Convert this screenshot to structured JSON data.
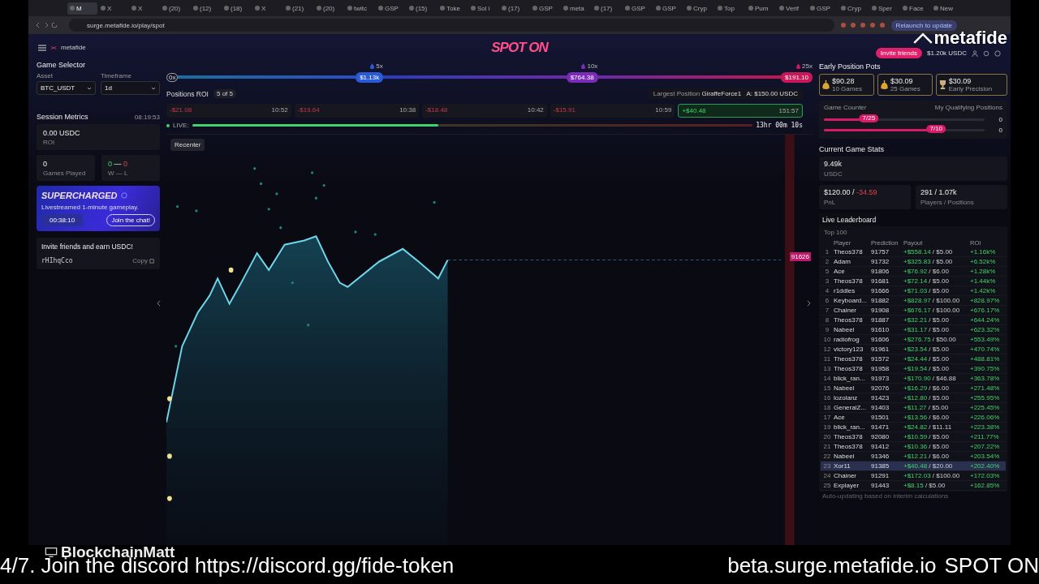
{
  "browser": {
    "tabs": [
      {
        "label": "M",
        "selected": true
      },
      {
        "label": "X",
        "selected": false
      },
      {
        "label": "X",
        "selected": false
      },
      {
        "label": "(20)",
        "selected": false
      },
      {
        "label": "(12)",
        "selected": false
      },
      {
        "label": "(18)",
        "selected": false
      },
      {
        "label": "X",
        "selected": false
      },
      {
        "label": "(21)",
        "selected": false
      },
      {
        "label": "(20)",
        "selected": false
      },
      {
        "label": "twitc",
        "selected": false
      },
      {
        "label": "GSP",
        "selected": false
      },
      {
        "label": "(15)",
        "selected": false
      },
      {
        "label": "Toke",
        "selected": false
      },
      {
        "label": "Sol i",
        "selected": false
      },
      {
        "label": "(17)",
        "selected": false
      },
      {
        "label": "GSP",
        "selected": false
      },
      {
        "label": "meta",
        "selected": false
      },
      {
        "label": "(17)",
        "selected": false
      },
      {
        "label": "GSP",
        "selected": false
      },
      {
        "label": "GSP",
        "selected": false
      },
      {
        "label": "Cryp",
        "selected": false
      },
      {
        "label": "Top",
        "selected": false
      },
      {
        "label": "Pum",
        "selected": false
      },
      {
        "label": "Verif",
        "selected": false
      },
      {
        "label": "GSP",
        "selected": false
      },
      {
        "label": "Cryp",
        "selected": false
      },
      {
        "label": "Sper",
        "selected": false
      },
      {
        "label": "Face",
        "selected": false
      },
      {
        "label": "New",
        "selected": false
      }
    ],
    "address": "surge.metafide.io/play/spot",
    "relaunch": "Relaunch to update"
  },
  "overlay": {
    "brand_logo": "metafide",
    "streamer": "BlockchainMatt",
    "ticker_left": "4/7. Join the discord https://discord.gg/fide-token",
    "ticker_site": "beta.surge.metafide.io",
    "ticker_end": "SPOT ON"
  },
  "header": {
    "brand": "metafide",
    "title": "SPOT ON",
    "invite_button": "Invite friends",
    "balance": "$1.20k USDC"
  },
  "sidebar": {
    "game_selector": {
      "title": "Game Selector",
      "asset_label": "Asset",
      "asset": "BTC_USDT",
      "timeframe_label": "Timeframe",
      "timeframe": "1d"
    },
    "session": {
      "title": "Session Metrics",
      "clock": "08:19:53",
      "roi_value": "0.00 USDC",
      "roi_label": "ROI",
      "games_value": "0",
      "games_label": "Games Played",
      "wins": "0",
      "wl_separator": "—",
      "losses": "0",
      "wl_label": "W — L"
    },
    "supercharged": {
      "title": "SUPERCHARGED",
      "text": "Livestreamed 1-minute gameplay.",
      "timer": "00:38:10",
      "button": "Join the chat!"
    },
    "invite": {
      "title": "Invite friends and earn USDC!",
      "code": "rHIhqCco",
      "copy": "Copy"
    }
  },
  "multiplier": {
    "start": "0x",
    "markers": [
      {
        "label": "5x",
        "value": "$1.13k",
        "color": "#2a5bd7"
      },
      {
        "label": "10x",
        "value": "$764.38",
        "color": "#7a2bb8"
      },
      {
        "label": "25x",
        "value": "$191.10",
        "color": "#c8185a"
      }
    ]
  },
  "positions": {
    "title": "Positions ROI",
    "count": "5 of 5",
    "largest_label": "Largest Position",
    "largest_name": "GiraffeForce1",
    "largest_amount": "A: $150.00 USDC",
    "cards": [
      {
        "amount": "-$21.08",
        "time": "10:52",
        "kind": "loss"
      },
      {
        "amount": "-$19.64",
        "time": "10:38",
        "kind": "loss"
      },
      {
        "amount": "-$18.48",
        "time": "10:42",
        "kind": "loss"
      },
      {
        "amount": "-$15.91",
        "time": "10:59",
        "kind": "loss"
      },
      {
        "amount": "+$40.48",
        "time": "151:57",
        "kind": "gain"
      }
    ]
  },
  "live": {
    "label": "LIVE:",
    "level": 0.44,
    "countdown": "13hr 00m 10s"
  },
  "chart": {
    "recenter": "Recenter",
    "price_tag": "91626"
  },
  "pots": {
    "title": "Early Position Pots",
    "cards": [
      {
        "amount": "$90.28",
        "label": "10 Games",
        "kind": "bag"
      },
      {
        "amount": "$30.09",
        "label": "25 Games",
        "kind": "bag"
      },
      {
        "amount": "$30.09",
        "label": "Early Precision",
        "kind": "trophy"
      }
    ],
    "counter_label": "Game Counter",
    "qualifying_label": "My Qualifying Positions",
    "counters": [
      {
        "label": "7/25",
        "level": 0.28,
        "value": "0"
      },
      {
        "label": "7/10",
        "level": 0.7,
        "value": "0"
      }
    ]
  },
  "stats": {
    "title": "Current Game Stats",
    "volume": "9.49k",
    "volume_label": "USDC",
    "pnl_pos": "$120.00",
    "pnl_separator": "/",
    "pnl_neg": "-34.59",
    "pnl_label": "PnL",
    "players": "291 / 1.07k",
    "players_label": "Players / Positions"
  },
  "leaderboard": {
    "title": "Live Leaderboard",
    "subtitle": "Top 100",
    "columns": [
      "Player",
      "Prediction",
      "Payout",
      "ROI"
    ],
    "payout_separator": "/",
    "rows": [
      {
        "rank": "1",
        "player": "Theos378",
        "prediction": "91757",
        "payout": "+$558.14",
        "bet": "$5.00",
        "roi": "+1.16k%",
        "selected": false
      },
      {
        "rank": "2",
        "player": "Adam",
        "prediction": "91732",
        "payout": "+$325.83",
        "bet": "$5.00",
        "roi": "+6.52k%",
        "selected": false
      },
      {
        "rank": "5",
        "player": "Ace",
        "prediction": "91806",
        "payout": "+$76.92",
        "bet": "$6.00",
        "roi": "+1.28k%",
        "selected": false
      },
      {
        "rank": "3",
        "player": "Theos378",
        "prediction": "91681",
        "payout": "+$72.14",
        "bet": "$5.00",
        "roi": "+1.44k%",
        "selected": false
      },
      {
        "rank": "4",
        "player": "r1ddles",
        "prediction": "91666",
        "payout": "+$71.03",
        "bet": "$5.00",
        "roi": "+1.42k%",
        "selected": false
      },
      {
        "rank": "6",
        "player": "Keyboard...",
        "prediction": "91882",
        "payout": "+$828.97",
        "bet": "$100.00",
        "roi": "+828.97%",
        "selected": false
      },
      {
        "rank": "7",
        "player": "Chainer",
        "prediction": "91908",
        "payout": "+$676.17",
        "bet": "$100.00",
        "roi": "+676.17%",
        "selected": false
      },
      {
        "rank": "8",
        "player": "Theos378",
        "prediction": "91887",
        "payout": "+$32.21",
        "bet": "$5.00",
        "roi": "+644.24%",
        "selected": false
      },
      {
        "rank": "9",
        "player": "Nabeel",
        "prediction": "91610",
        "payout": "+$31.17",
        "bet": "$5.00",
        "roi": "+623.32%",
        "selected": false
      },
      {
        "rank": "10",
        "player": "radiofrog",
        "prediction": "91606",
        "payout": "+$276.75",
        "bet": "$50.00",
        "roi": "+553.49%",
        "selected": false
      },
      {
        "rank": "12",
        "player": "victory123",
        "prediction": "91961",
        "payout": "+$23.54",
        "bet": "$5.00",
        "roi": "+470.74%",
        "selected": false
      },
      {
        "rank": "11",
        "player": "Theos378",
        "prediction": "91572",
        "payout": "+$24.44",
        "bet": "$5.00",
        "roi": "+488.81%",
        "selected": false
      },
      {
        "rank": "13",
        "player": "Theos378",
        "prediction": "91958",
        "payout": "+$19.54",
        "bet": "$5.00",
        "roi": "+390.75%",
        "selected": false
      },
      {
        "rank": "14",
        "player": "blick_ran...",
        "prediction": "91973",
        "payout": "+$170.90",
        "bet": "$46.88",
        "roi": "+363.78%",
        "selected": false
      },
      {
        "rank": "15",
        "player": "Nabeel",
        "prediction": "92076",
        "payout": "+$16.29",
        "bet": "$6.00",
        "roi": "+271.48%",
        "selected": false
      },
      {
        "rank": "16",
        "player": "lozolanz",
        "prediction": "91423",
        "payout": "+$12.80",
        "bet": "$5.00",
        "roi": "+255.95%",
        "selected": false
      },
      {
        "rank": "18",
        "player": "GeneralZ...",
        "prediction": "91403",
        "payout": "+$11.27",
        "bet": "$5.00",
        "roi": "+225.45%",
        "selected": false
      },
      {
        "rank": "17",
        "player": "Ace",
        "prediction": "91501",
        "payout": "+$13.56",
        "bet": "$6.00",
        "roi": "+226.06%",
        "selected": false
      },
      {
        "rank": "19",
        "player": "blick_ran...",
        "prediction": "91471",
        "payout": "+$24.82",
        "bet": "$11.11",
        "roi": "+223.38%",
        "selected": false
      },
      {
        "rank": "20",
        "player": "Theos378",
        "prediction": "92080",
        "payout": "+$10.59",
        "bet": "$5.00",
        "roi": "+211.77%",
        "selected": false
      },
      {
        "rank": "21",
        "player": "Theos378",
        "prediction": "91412",
        "payout": "+$10.36",
        "bet": "$5.00",
        "roi": "+207.22%",
        "selected": false
      },
      {
        "rank": "22",
        "player": "Nabeel",
        "prediction": "91346",
        "payout": "+$12.21",
        "bet": "$6.00",
        "roi": "+203.54%",
        "selected": false
      },
      {
        "rank": "23",
        "player": "Xor11",
        "prediction": "91385",
        "payout": "+$40.48",
        "bet": "$20.00",
        "roi": "+202.40%",
        "selected": true
      },
      {
        "rank": "24",
        "player": "Chainer",
        "prediction": "91291",
        "payout": "+$172.03",
        "bet": "$100.00",
        "roi": "+172.03%",
        "selected": false
      },
      {
        "rank": "25",
        "player": "Explayer",
        "prediction": "91443",
        "payout": "+$8.15",
        "bet": "$5.00",
        "roi": "+162.85%",
        "selected": false
      }
    ],
    "footnote": "Auto-updating based on interim calculations"
  }
}
